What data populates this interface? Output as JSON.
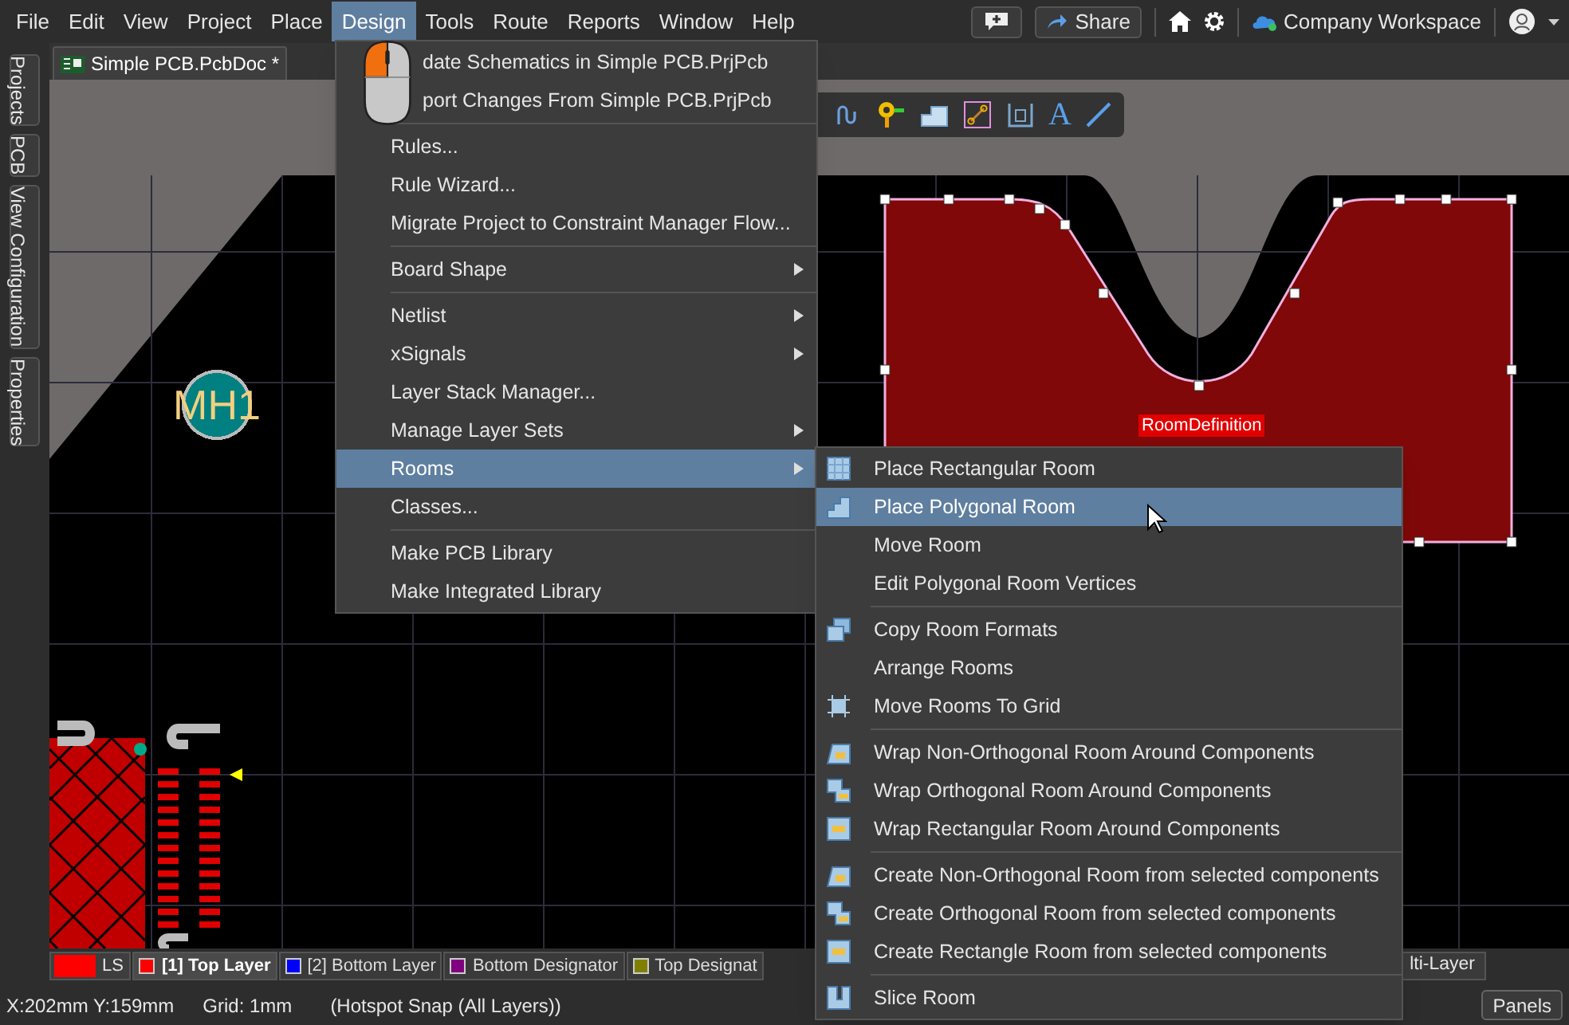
{
  "menu_bar": {
    "items": [
      {
        "label": "File",
        "selected": false
      },
      {
        "label": "Edit",
        "selected": false
      },
      {
        "label": "View",
        "selected": false
      },
      {
        "label": "Project",
        "selected": false
      },
      {
        "label": "Place",
        "selected": false
      },
      {
        "label": "Design",
        "selected": true
      },
      {
        "label": "Tools",
        "selected": false
      },
      {
        "label": "Route",
        "selected": false
      },
      {
        "label": "Reports",
        "selected": false
      },
      {
        "label": "Window",
        "selected": false
      },
      {
        "label": "Help",
        "selected": false
      }
    ],
    "share_button": "Share",
    "workspace": "Company Workspace"
  },
  "side_panels": [
    "Projects",
    "PCB",
    "View Configuration",
    "Properties"
  ],
  "document_tab": {
    "label": "Simple PCB.PcbDoc *"
  },
  "toolbar": {
    "text_tool": "A"
  },
  "canvas": {
    "hole_label": "MH1",
    "room_label": "RoomDefinition"
  },
  "design_menu": {
    "groups": [
      [
        {
          "label": "date Schematics in Simple PCB.PrjPcb",
          "submenu": false,
          "selected": false
        },
        {
          "label": "port Changes From Simple PCB.PrjPcb",
          "submenu": false,
          "selected": false
        }
      ],
      [
        {
          "label": "Rules...",
          "submenu": false,
          "selected": false
        },
        {
          "label": "Rule Wizard...",
          "submenu": false,
          "selected": false
        },
        {
          "label": "Migrate Project to Constraint Manager Flow...",
          "submenu": false,
          "selected": false
        }
      ],
      [
        {
          "label": "Board Shape",
          "submenu": true,
          "selected": false
        }
      ],
      [
        {
          "label": "Netlist",
          "submenu": true,
          "selected": false
        },
        {
          "label": "xSignals",
          "submenu": true,
          "selected": false
        },
        {
          "label": "Layer Stack Manager...",
          "submenu": false,
          "selected": false
        },
        {
          "label": "Manage Layer Sets",
          "submenu": true,
          "selected": false
        },
        {
          "label": "Rooms",
          "submenu": true,
          "selected": true
        },
        {
          "label": "Classes...",
          "submenu": false,
          "selected": false
        }
      ],
      [
        {
          "label": "Make PCB Library",
          "submenu": false,
          "selected": false
        },
        {
          "label": "Make Integrated Library",
          "submenu": false,
          "selected": false
        }
      ]
    ]
  },
  "rooms_submenu": {
    "groups": [
      [
        {
          "label": "Place Rectangular Room",
          "selected": false
        },
        {
          "label": "Place Polygonal Room",
          "selected": true
        },
        {
          "label": "Move Room",
          "selected": false
        },
        {
          "label": "Edit Polygonal Room Vertices",
          "selected": false
        }
      ],
      [
        {
          "label": "Copy Room Formats",
          "selected": false
        },
        {
          "label": "Arrange Rooms",
          "selected": false
        },
        {
          "label": "Move Rooms To Grid",
          "selected": false
        }
      ],
      [
        {
          "label": "Wrap Non-Orthogonal Room Around Components",
          "selected": false
        },
        {
          "label": "Wrap Orthogonal Room Around Components",
          "selected": false
        },
        {
          "label": "Wrap Rectangular Room Around Components",
          "selected": false
        }
      ],
      [
        {
          "label": "Create Non-Orthogonal Room from selected components",
          "selected": false
        },
        {
          "label": "Create Orthogonal Room from selected components",
          "selected": false
        },
        {
          "label": "Create Rectangle Room from selected components",
          "selected": false
        }
      ],
      [
        {
          "label": "Slice Room",
          "selected": false
        }
      ]
    ]
  },
  "layer_bar": {
    "layer_set": {
      "label": "LS",
      "color": "#ff0000"
    },
    "layers": [
      {
        "label": "[1] Top Layer",
        "color": "#ff0000",
        "selected": true
      },
      {
        "label": "[2] Bottom Layer",
        "color": "#0000ff",
        "selected": false
      },
      {
        "label": "Bottom Designator",
        "color": "#800080",
        "selected": false
      },
      {
        "label": "Top Designat",
        "color": "#808000",
        "selected": false
      }
    ],
    "last_layer": "lti-Layer"
  },
  "status_bar": {
    "position": "X:202mm Y:159mm",
    "grid": "Grid: 1mm",
    "snap": "(Hotspot Snap (All Layers))",
    "panels_button": "Panels"
  }
}
